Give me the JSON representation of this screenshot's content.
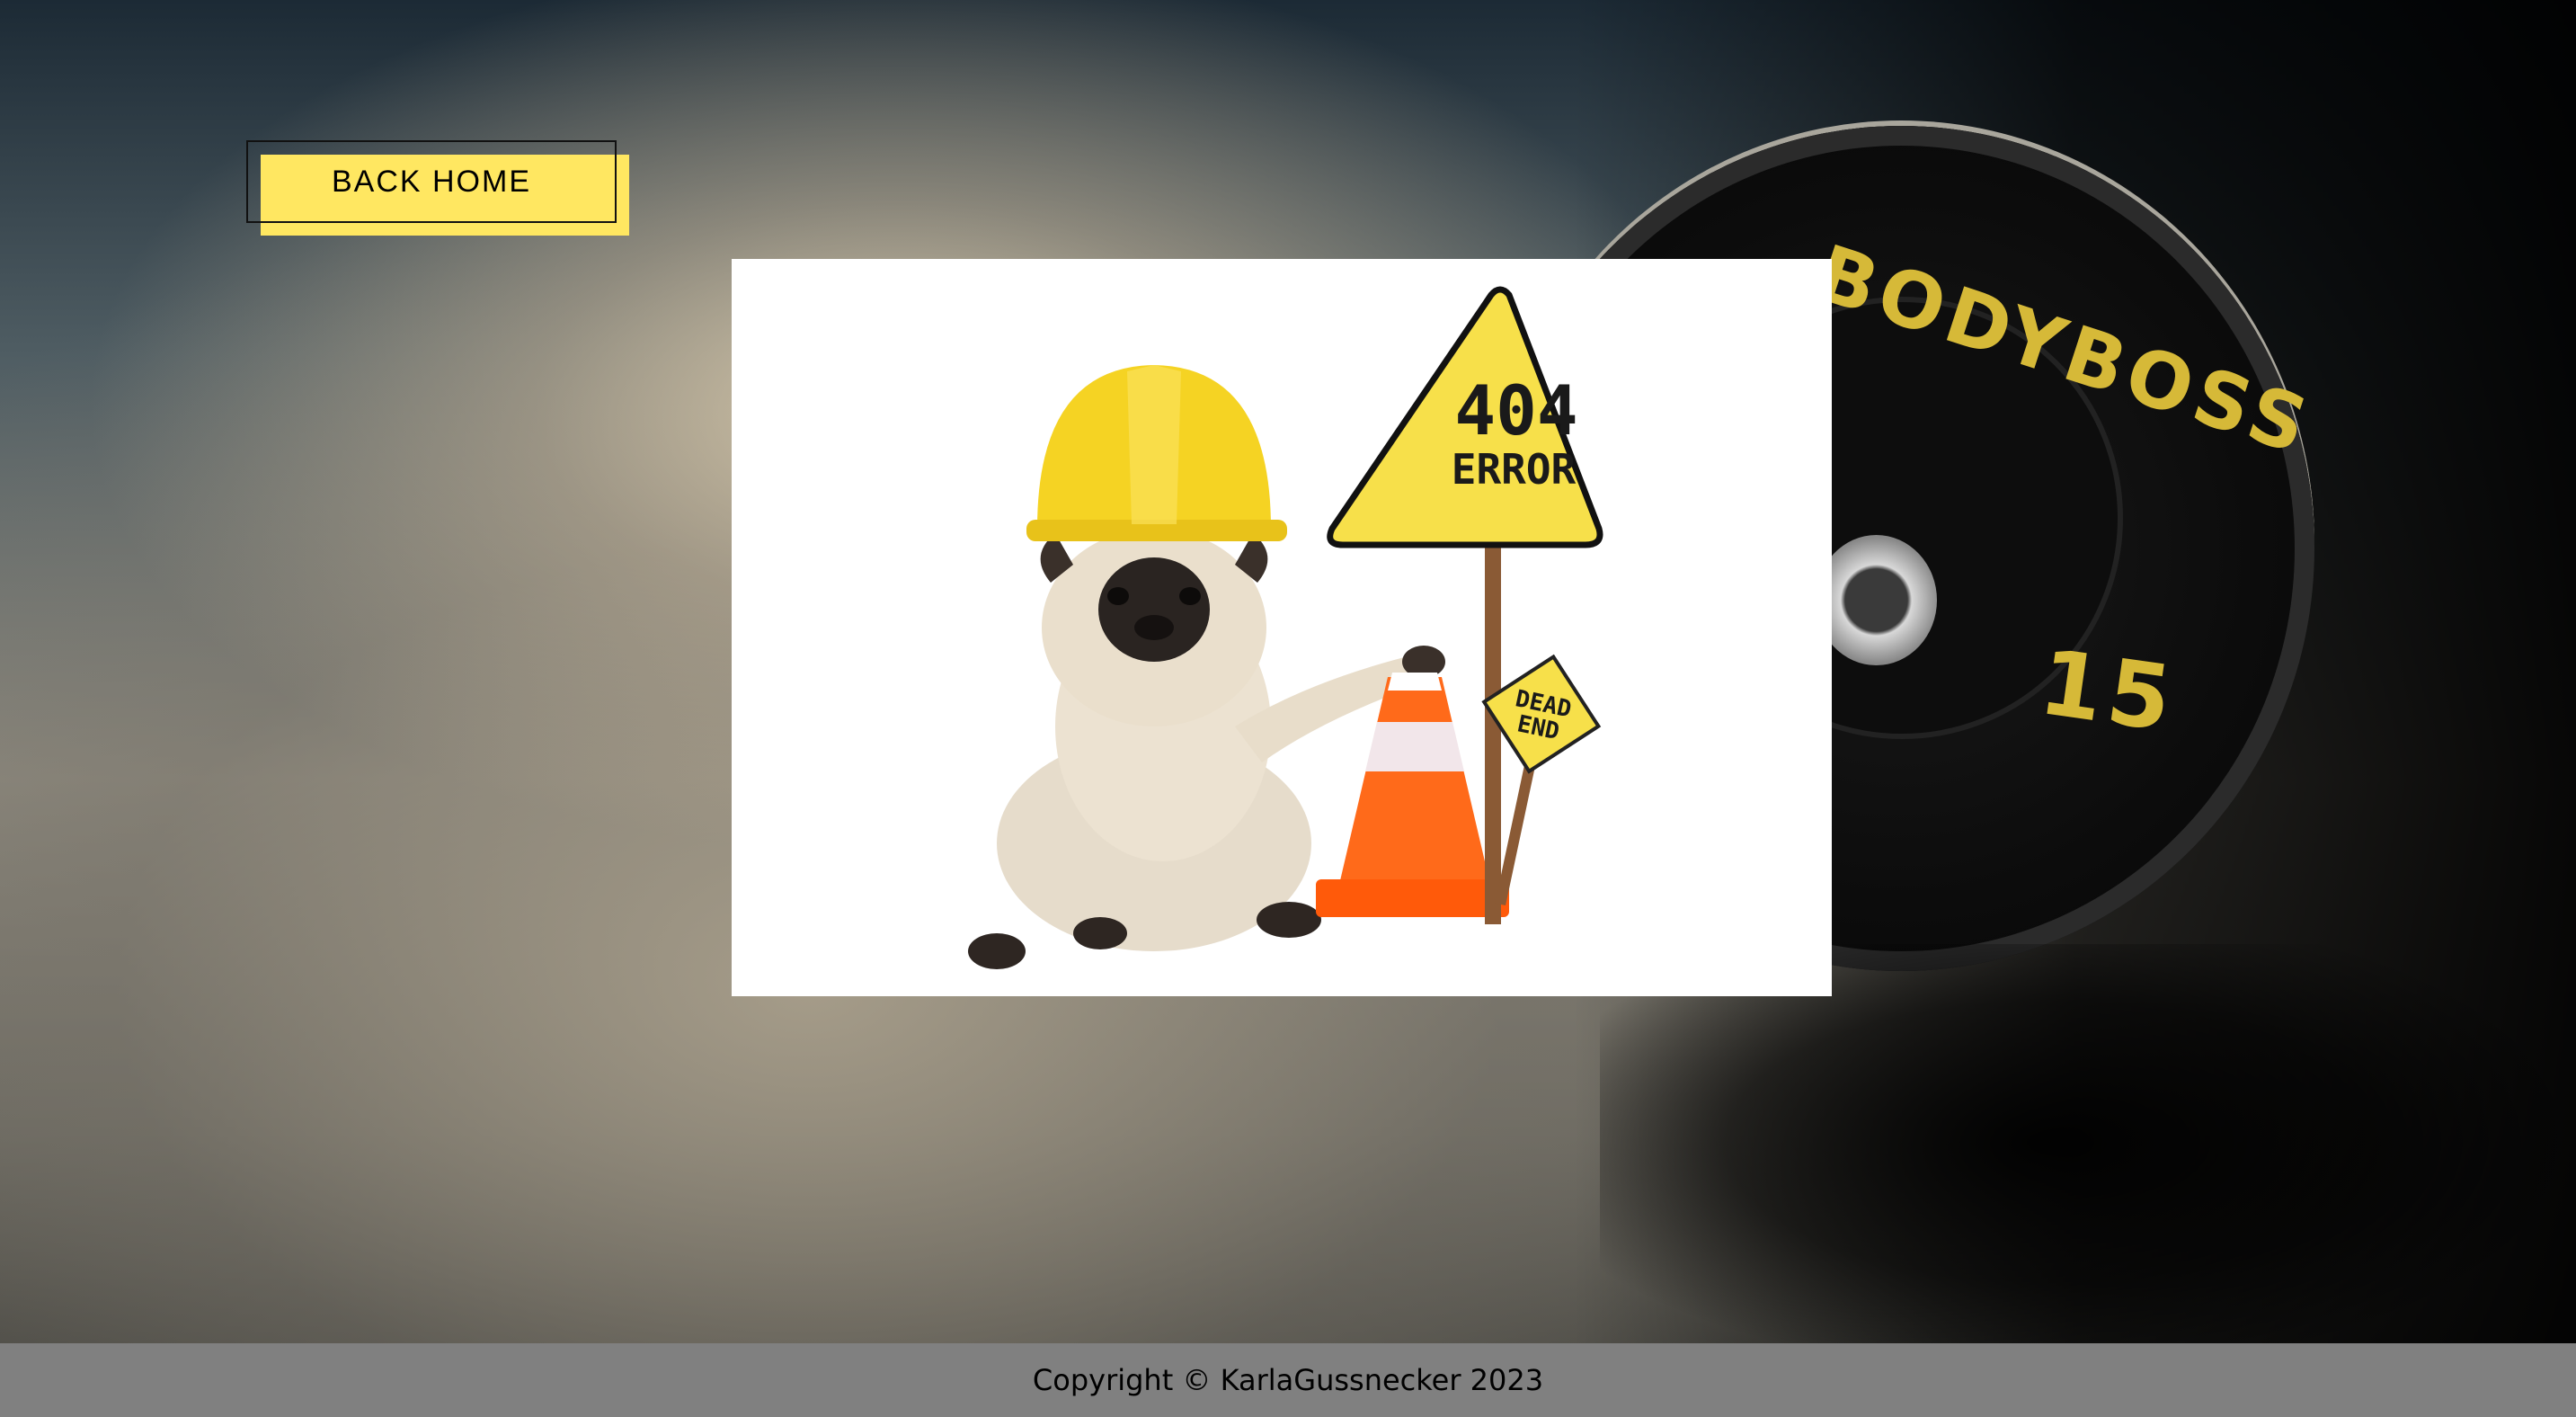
{
  "back_button": {
    "label": "BACK HOME",
    "accent_color": "#ffe761"
  },
  "illustration": {
    "sign_main_line1": "404",
    "sign_main_line2": "ERROR",
    "sign_small_line1": "DEAD",
    "sign_small_line2": "END",
    "sign_color": "#f7e04a",
    "cone_color": "#ff6a1a",
    "helmet_color": "#f5d323"
  },
  "background": {
    "plate_brand": "BODYBOSS",
    "plate_weight": "15",
    "plate_text_color": "#d6b938"
  },
  "footer": {
    "text": "Copyright © KarlaGussnecker 2023",
    "background_color": "#808080"
  }
}
